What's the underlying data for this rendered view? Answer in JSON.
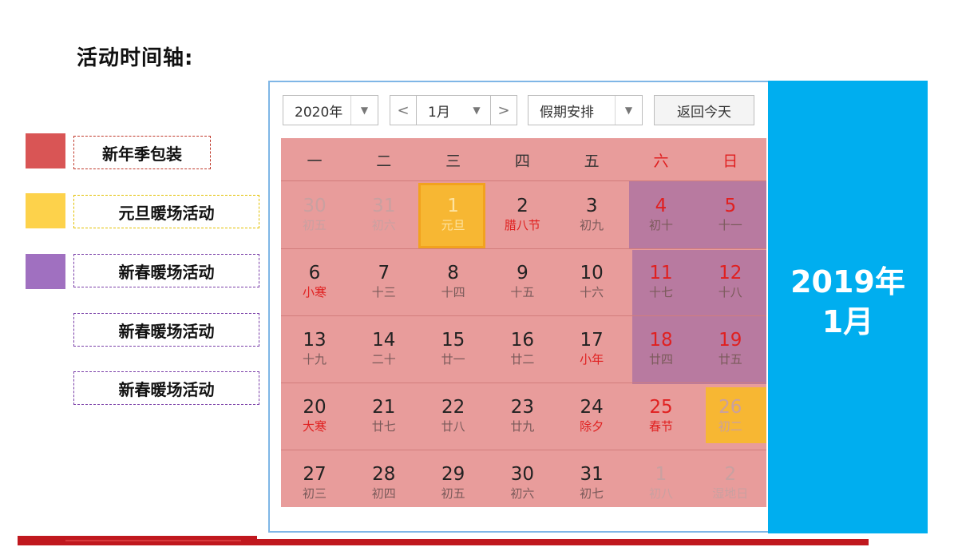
{
  "title": "活动时间轴:",
  "legend": [
    {
      "label": "新年季包装",
      "color": "#d95555",
      "border": "#c0392b"
    },
    {
      "label": "元旦暖场活动",
      "color": "#fdd24b",
      "border": "#e2c000"
    },
    {
      "label": "新春暖场活动",
      "color": "#a070c0",
      "border": "#7a3fa8"
    },
    {
      "label": "新春暖场活动",
      "color": "",
      "border": "#7a3fa8"
    },
    {
      "label": "新春暖场活动",
      "color": "",
      "border": "#7a3fa8"
    }
  ],
  "toolbar": {
    "year": "2020年",
    "prev": "<",
    "month": "1月",
    "next": ">",
    "holiday": "假期安排",
    "today": "返回今天",
    "dropdown_icon": "▼"
  },
  "weekdays": [
    "一",
    "二",
    "三",
    "四",
    "五",
    "六",
    "日"
  ],
  "weeks": [
    [
      {
        "d": "30",
        "l": "初五",
        "m": true
      },
      {
        "d": "31",
        "l": "初六",
        "m": true
      },
      {
        "d": "1",
        "l": "元旦",
        "sel": true
      },
      {
        "d": "2",
        "l": "腊八节",
        "lr": true
      },
      {
        "d": "3",
        "l": "初九"
      },
      {
        "d": "4",
        "l": "初十",
        "dr": true
      },
      {
        "d": "5",
        "l": "十一",
        "dr": true
      }
    ],
    [
      {
        "d": "6",
        "l": "小寒",
        "lr": true
      },
      {
        "d": "7",
        "l": "十三"
      },
      {
        "d": "8",
        "l": "十四"
      },
      {
        "d": "9",
        "l": "十五"
      },
      {
        "d": "10",
        "l": "十六"
      },
      {
        "d": "11",
        "l": "十七",
        "dr": true
      },
      {
        "d": "12",
        "l": "十八",
        "dr": true
      }
    ],
    [
      {
        "d": "13",
        "l": "十九"
      },
      {
        "d": "14",
        "l": "二十"
      },
      {
        "d": "15",
        "l": "廿一"
      },
      {
        "d": "16",
        "l": "廿二"
      },
      {
        "d": "17",
        "l": "小年",
        "lr": true
      },
      {
        "d": "18",
        "l": "廿四",
        "dr": true
      },
      {
        "d": "19",
        "l": "廿五",
        "dr": true
      }
    ],
    [
      {
        "d": "20",
        "l": "大寒",
        "lr": true
      },
      {
        "d": "21",
        "l": "廿七"
      },
      {
        "d": "22",
        "l": "廿八"
      },
      {
        "d": "23",
        "l": "廿九"
      },
      {
        "d": "24",
        "l": "除夕",
        "lr": true
      },
      {
        "d": "25",
        "l": "春节",
        "lr": true,
        "dr": true
      },
      {
        "d": "26",
        "l": "初二",
        "m": true
      }
    ],
    [
      {
        "d": "27",
        "l": "初三"
      },
      {
        "d": "28",
        "l": "初四"
      },
      {
        "d": "29",
        "l": "初五"
      },
      {
        "d": "30",
        "l": "初六"
      },
      {
        "d": "31",
        "l": "初七"
      },
      {
        "d": "1",
        "l": "初八",
        "m": true
      },
      {
        "d": "2",
        "l": "湿地日",
        "m": true
      }
    ]
  ],
  "panel": {
    "line1": "2019年",
    "line2": "1月"
  },
  "colors": {
    "grid": "#e89c9b",
    "purple": "#b87aa0",
    "orange": "#f7b733",
    "blue": "#00aeef",
    "red": "#e02020",
    "bar": "#c0181e"
  }
}
